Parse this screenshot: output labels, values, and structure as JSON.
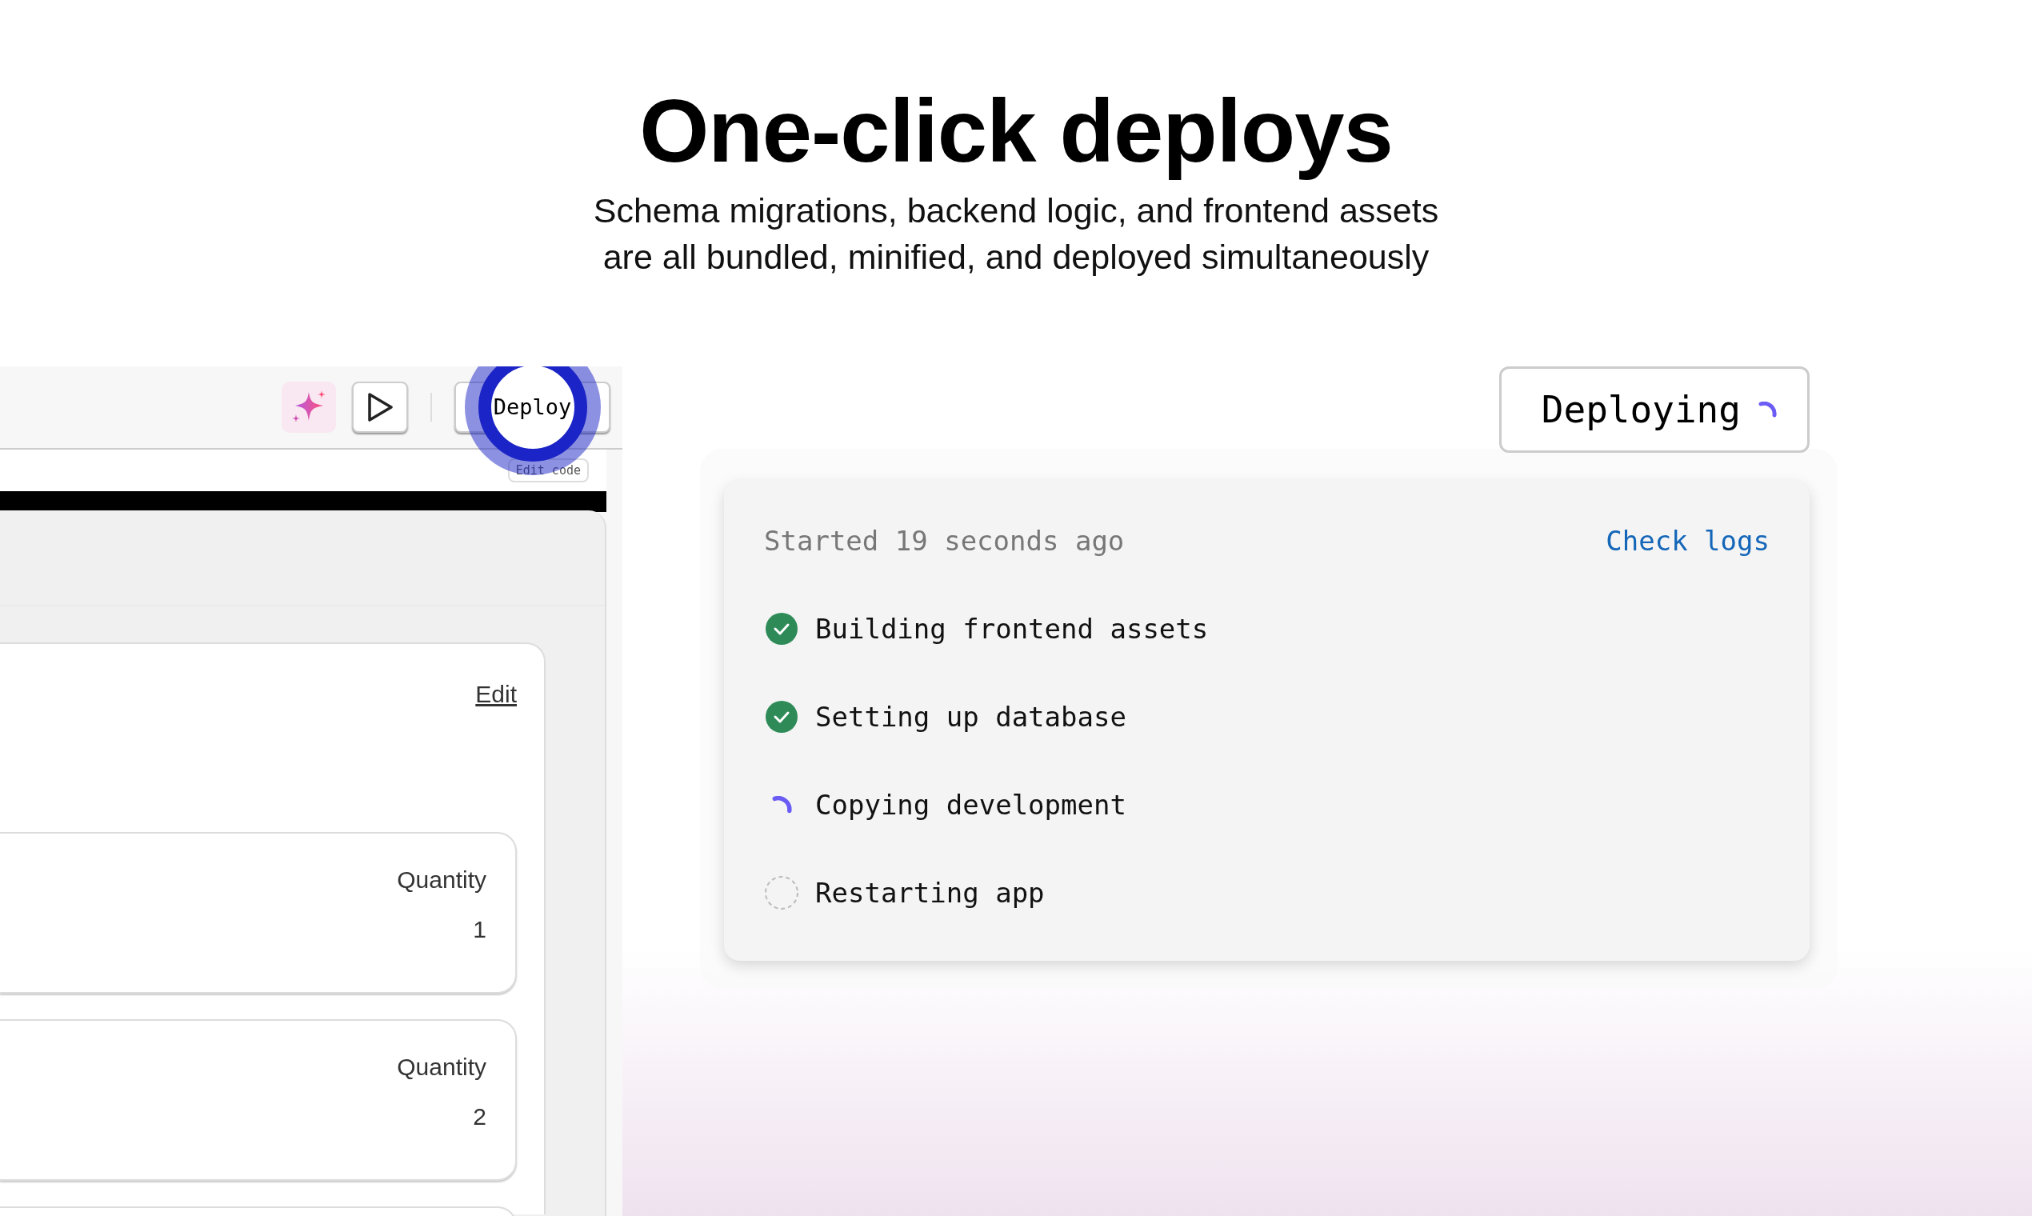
{
  "heading": "One-click deploys",
  "subheading": "Schema migrations, backend logic, and frontend assets\nare all bundled, minified, and deployed simultaneously",
  "editor": {
    "toolbar": {
      "deploy_label": "Deploy",
      "deploy_highlighted": true
    },
    "edit_code": "Edit code",
    "card": {
      "action": "Edit",
      "items": [
        {
          "label": "Quantity",
          "value": "1"
        },
        {
          "label": "Quantity",
          "value": "2"
        }
      ]
    }
  },
  "deploy_status": {
    "button": {
      "label": "Deploying",
      "busy": true
    },
    "started": "Started 19 seconds ago",
    "logs_link": "Check logs",
    "steps": [
      {
        "label": "Building frontend assets",
        "completed": true,
        "in_progress": false
      },
      {
        "label": "Setting up database",
        "completed": true,
        "in_progress": false
      },
      {
        "label": "Copying development",
        "completed": false,
        "in_progress": true
      },
      {
        "label": "Restarting app",
        "completed": false,
        "in_progress": false
      }
    ]
  }
}
